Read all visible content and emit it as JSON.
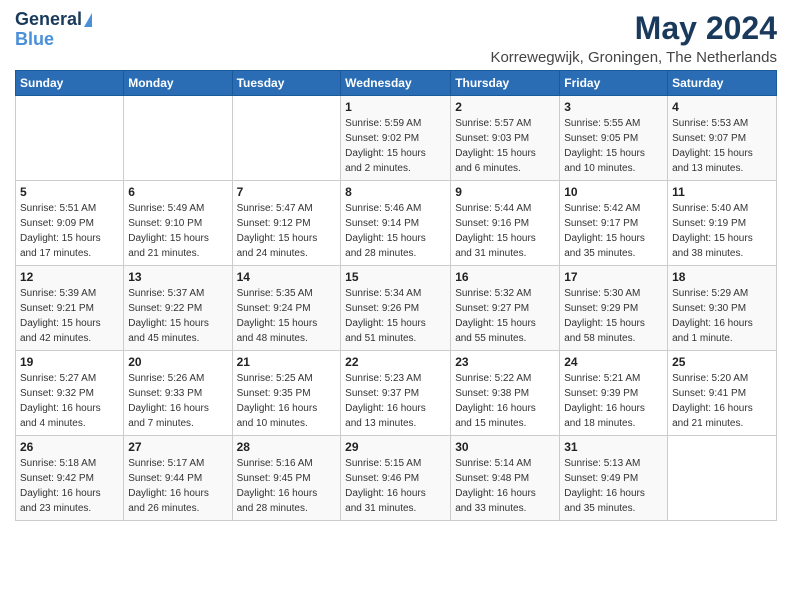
{
  "logo": {
    "line1": "General",
    "line2": "Blue"
  },
  "title": "May 2024",
  "subtitle": "Korrewegwijk, Groningen, The Netherlands",
  "weekdays": [
    "Sunday",
    "Monday",
    "Tuesday",
    "Wednesday",
    "Thursday",
    "Friday",
    "Saturday"
  ],
  "weeks": [
    [
      {
        "day": "",
        "info": ""
      },
      {
        "day": "",
        "info": ""
      },
      {
        "day": "",
        "info": ""
      },
      {
        "day": "1",
        "info": "Sunrise: 5:59 AM\nSunset: 9:02 PM\nDaylight: 15 hours\nand 2 minutes."
      },
      {
        "day": "2",
        "info": "Sunrise: 5:57 AM\nSunset: 9:03 PM\nDaylight: 15 hours\nand 6 minutes."
      },
      {
        "day": "3",
        "info": "Sunrise: 5:55 AM\nSunset: 9:05 PM\nDaylight: 15 hours\nand 10 minutes."
      },
      {
        "day": "4",
        "info": "Sunrise: 5:53 AM\nSunset: 9:07 PM\nDaylight: 15 hours\nand 13 minutes."
      }
    ],
    [
      {
        "day": "5",
        "info": "Sunrise: 5:51 AM\nSunset: 9:09 PM\nDaylight: 15 hours\nand 17 minutes."
      },
      {
        "day": "6",
        "info": "Sunrise: 5:49 AM\nSunset: 9:10 PM\nDaylight: 15 hours\nand 21 minutes."
      },
      {
        "day": "7",
        "info": "Sunrise: 5:47 AM\nSunset: 9:12 PM\nDaylight: 15 hours\nand 24 minutes."
      },
      {
        "day": "8",
        "info": "Sunrise: 5:46 AM\nSunset: 9:14 PM\nDaylight: 15 hours\nand 28 minutes."
      },
      {
        "day": "9",
        "info": "Sunrise: 5:44 AM\nSunset: 9:16 PM\nDaylight: 15 hours\nand 31 minutes."
      },
      {
        "day": "10",
        "info": "Sunrise: 5:42 AM\nSunset: 9:17 PM\nDaylight: 15 hours\nand 35 minutes."
      },
      {
        "day": "11",
        "info": "Sunrise: 5:40 AM\nSunset: 9:19 PM\nDaylight: 15 hours\nand 38 minutes."
      }
    ],
    [
      {
        "day": "12",
        "info": "Sunrise: 5:39 AM\nSunset: 9:21 PM\nDaylight: 15 hours\nand 42 minutes."
      },
      {
        "day": "13",
        "info": "Sunrise: 5:37 AM\nSunset: 9:22 PM\nDaylight: 15 hours\nand 45 minutes."
      },
      {
        "day": "14",
        "info": "Sunrise: 5:35 AM\nSunset: 9:24 PM\nDaylight: 15 hours\nand 48 minutes."
      },
      {
        "day": "15",
        "info": "Sunrise: 5:34 AM\nSunset: 9:26 PM\nDaylight: 15 hours\nand 51 minutes."
      },
      {
        "day": "16",
        "info": "Sunrise: 5:32 AM\nSunset: 9:27 PM\nDaylight: 15 hours\nand 55 minutes."
      },
      {
        "day": "17",
        "info": "Sunrise: 5:30 AM\nSunset: 9:29 PM\nDaylight: 15 hours\nand 58 minutes."
      },
      {
        "day": "18",
        "info": "Sunrise: 5:29 AM\nSunset: 9:30 PM\nDaylight: 16 hours\nand 1 minute."
      }
    ],
    [
      {
        "day": "19",
        "info": "Sunrise: 5:27 AM\nSunset: 9:32 PM\nDaylight: 16 hours\nand 4 minutes."
      },
      {
        "day": "20",
        "info": "Sunrise: 5:26 AM\nSunset: 9:33 PM\nDaylight: 16 hours\nand 7 minutes."
      },
      {
        "day": "21",
        "info": "Sunrise: 5:25 AM\nSunset: 9:35 PM\nDaylight: 16 hours\nand 10 minutes."
      },
      {
        "day": "22",
        "info": "Sunrise: 5:23 AM\nSunset: 9:37 PM\nDaylight: 16 hours\nand 13 minutes."
      },
      {
        "day": "23",
        "info": "Sunrise: 5:22 AM\nSunset: 9:38 PM\nDaylight: 16 hours\nand 15 minutes."
      },
      {
        "day": "24",
        "info": "Sunrise: 5:21 AM\nSunset: 9:39 PM\nDaylight: 16 hours\nand 18 minutes."
      },
      {
        "day": "25",
        "info": "Sunrise: 5:20 AM\nSunset: 9:41 PM\nDaylight: 16 hours\nand 21 minutes."
      }
    ],
    [
      {
        "day": "26",
        "info": "Sunrise: 5:18 AM\nSunset: 9:42 PM\nDaylight: 16 hours\nand 23 minutes."
      },
      {
        "day": "27",
        "info": "Sunrise: 5:17 AM\nSunset: 9:44 PM\nDaylight: 16 hours\nand 26 minutes."
      },
      {
        "day": "28",
        "info": "Sunrise: 5:16 AM\nSunset: 9:45 PM\nDaylight: 16 hours\nand 28 minutes."
      },
      {
        "day": "29",
        "info": "Sunrise: 5:15 AM\nSunset: 9:46 PM\nDaylight: 16 hours\nand 31 minutes."
      },
      {
        "day": "30",
        "info": "Sunrise: 5:14 AM\nSunset: 9:48 PM\nDaylight: 16 hours\nand 33 minutes."
      },
      {
        "day": "31",
        "info": "Sunrise: 5:13 AM\nSunset: 9:49 PM\nDaylight: 16 hours\nand 35 minutes."
      },
      {
        "day": "",
        "info": ""
      }
    ]
  ]
}
